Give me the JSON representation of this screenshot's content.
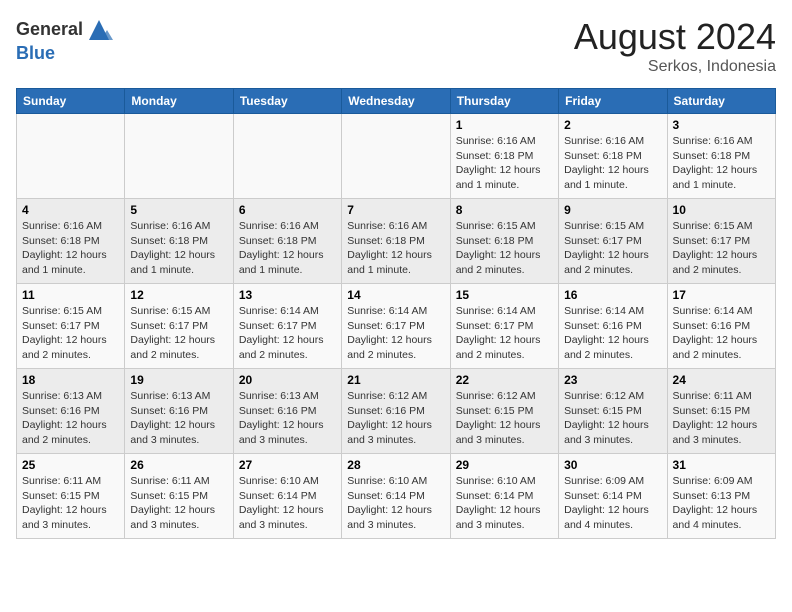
{
  "header": {
    "logo_line1": "General",
    "logo_line2": "Blue",
    "month_title": "August 2024",
    "location": "Serkos, Indonesia"
  },
  "days_of_week": [
    "Sunday",
    "Monday",
    "Tuesday",
    "Wednesday",
    "Thursday",
    "Friday",
    "Saturday"
  ],
  "weeks": [
    [
      {
        "day": "",
        "info": ""
      },
      {
        "day": "",
        "info": ""
      },
      {
        "day": "",
        "info": ""
      },
      {
        "day": "",
        "info": ""
      },
      {
        "day": "1",
        "info": "Sunrise: 6:16 AM\nSunset: 6:18 PM\nDaylight: 12 hours and 1 minute."
      },
      {
        "day": "2",
        "info": "Sunrise: 6:16 AM\nSunset: 6:18 PM\nDaylight: 12 hours and 1 minute."
      },
      {
        "day": "3",
        "info": "Sunrise: 6:16 AM\nSunset: 6:18 PM\nDaylight: 12 hours and 1 minute."
      }
    ],
    [
      {
        "day": "4",
        "info": "Sunrise: 6:16 AM\nSunset: 6:18 PM\nDaylight: 12 hours and 1 minute."
      },
      {
        "day": "5",
        "info": "Sunrise: 6:16 AM\nSunset: 6:18 PM\nDaylight: 12 hours and 1 minute."
      },
      {
        "day": "6",
        "info": "Sunrise: 6:16 AM\nSunset: 6:18 PM\nDaylight: 12 hours and 1 minute."
      },
      {
        "day": "7",
        "info": "Sunrise: 6:16 AM\nSunset: 6:18 PM\nDaylight: 12 hours and 1 minute."
      },
      {
        "day": "8",
        "info": "Sunrise: 6:15 AM\nSunset: 6:18 PM\nDaylight: 12 hours and 2 minutes."
      },
      {
        "day": "9",
        "info": "Sunrise: 6:15 AM\nSunset: 6:17 PM\nDaylight: 12 hours and 2 minutes."
      },
      {
        "day": "10",
        "info": "Sunrise: 6:15 AM\nSunset: 6:17 PM\nDaylight: 12 hours and 2 minutes."
      }
    ],
    [
      {
        "day": "11",
        "info": "Sunrise: 6:15 AM\nSunset: 6:17 PM\nDaylight: 12 hours and 2 minutes."
      },
      {
        "day": "12",
        "info": "Sunrise: 6:15 AM\nSunset: 6:17 PM\nDaylight: 12 hours and 2 minutes."
      },
      {
        "day": "13",
        "info": "Sunrise: 6:14 AM\nSunset: 6:17 PM\nDaylight: 12 hours and 2 minutes."
      },
      {
        "day": "14",
        "info": "Sunrise: 6:14 AM\nSunset: 6:17 PM\nDaylight: 12 hours and 2 minutes."
      },
      {
        "day": "15",
        "info": "Sunrise: 6:14 AM\nSunset: 6:17 PM\nDaylight: 12 hours and 2 minutes."
      },
      {
        "day": "16",
        "info": "Sunrise: 6:14 AM\nSunset: 6:16 PM\nDaylight: 12 hours and 2 minutes."
      },
      {
        "day": "17",
        "info": "Sunrise: 6:14 AM\nSunset: 6:16 PM\nDaylight: 12 hours and 2 minutes."
      }
    ],
    [
      {
        "day": "18",
        "info": "Sunrise: 6:13 AM\nSunset: 6:16 PM\nDaylight: 12 hours and 2 minutes."
      },
      {
        "day": "19",
        "info": "Sunrise: 6:13 AM\nSunset: 6:16 PM\nDaylight: 12 hours and 3 minutes."
      },
      {
        "day": "20",
        "info": "Sunrise: 6:13 AM\nSunset: 6:16 PM\nDaylight: 12 hours and 3 minutes."
      },
      {
        "day": "21",
        "info": "Sunrise: 6:12 AM\nSunset: 6:16 PM\nDaylight: 12 hours and 3 minutes."
      },
      {
        "day": "22",
        "info": "Sunrise: 6:12 AM\nSunset: 6:15 PM\nDaylight: 12 hours and 3 minutes."
      },
      {
        "day": "23",
        "info": "Sunrise: 6:12 AM\nSunset: 6:15 PM\nDaylight: 12 hours and 3 minutes."
      },
      {
        "day": "24",
        "info": "Sunrise: 6:11 AM\nSunset: 6:15 PM\nDaylight: 12 hours and 3 minutes."
      }
    ],
    [
      {
        "day": "25",
        "info": "Sunrise: 6:11 AM\nSunset: 6:15 PM\nDaylight: 12 hours and 3 minutes."
      },
      {
        "day": "26",
        "info": "Sunrise: 6:11 AM\nSunset: 6:15 PM\nDaylight: 12 hours and 3 minutes."
      },
      {
        "day": "27",
        "info": "Sunrise: 6:10 AM\nSunset: 6:14 PM\nDaylight: 12 hours and 3 minutes."
      },
      {
        "day": "28",
        "info": "Sunrise: 6:10 AM\nSunset: 6:14 PM\nDaylight: 12 hours and 3 minutes."
      },
      {
        "day": "29",
        "info": "Sunrise: 6:10 AM\nSunset: 6:14 PM\nDaylight: 12 hours and 3 minutes."
      },
      {
        "day": "30",
        "info": "Sunrise: 6:09 AM\nSunset: 6:14 PM\nDaylight: 12 hours and 4 minutes."
      },
      {
        "day": "31",
        "info": "Sunrise: 6:09 AM\nSunset: 6:13 PM\nDaylight: 12 hours and 4 minutes."
      }
    ]
  ]
}
